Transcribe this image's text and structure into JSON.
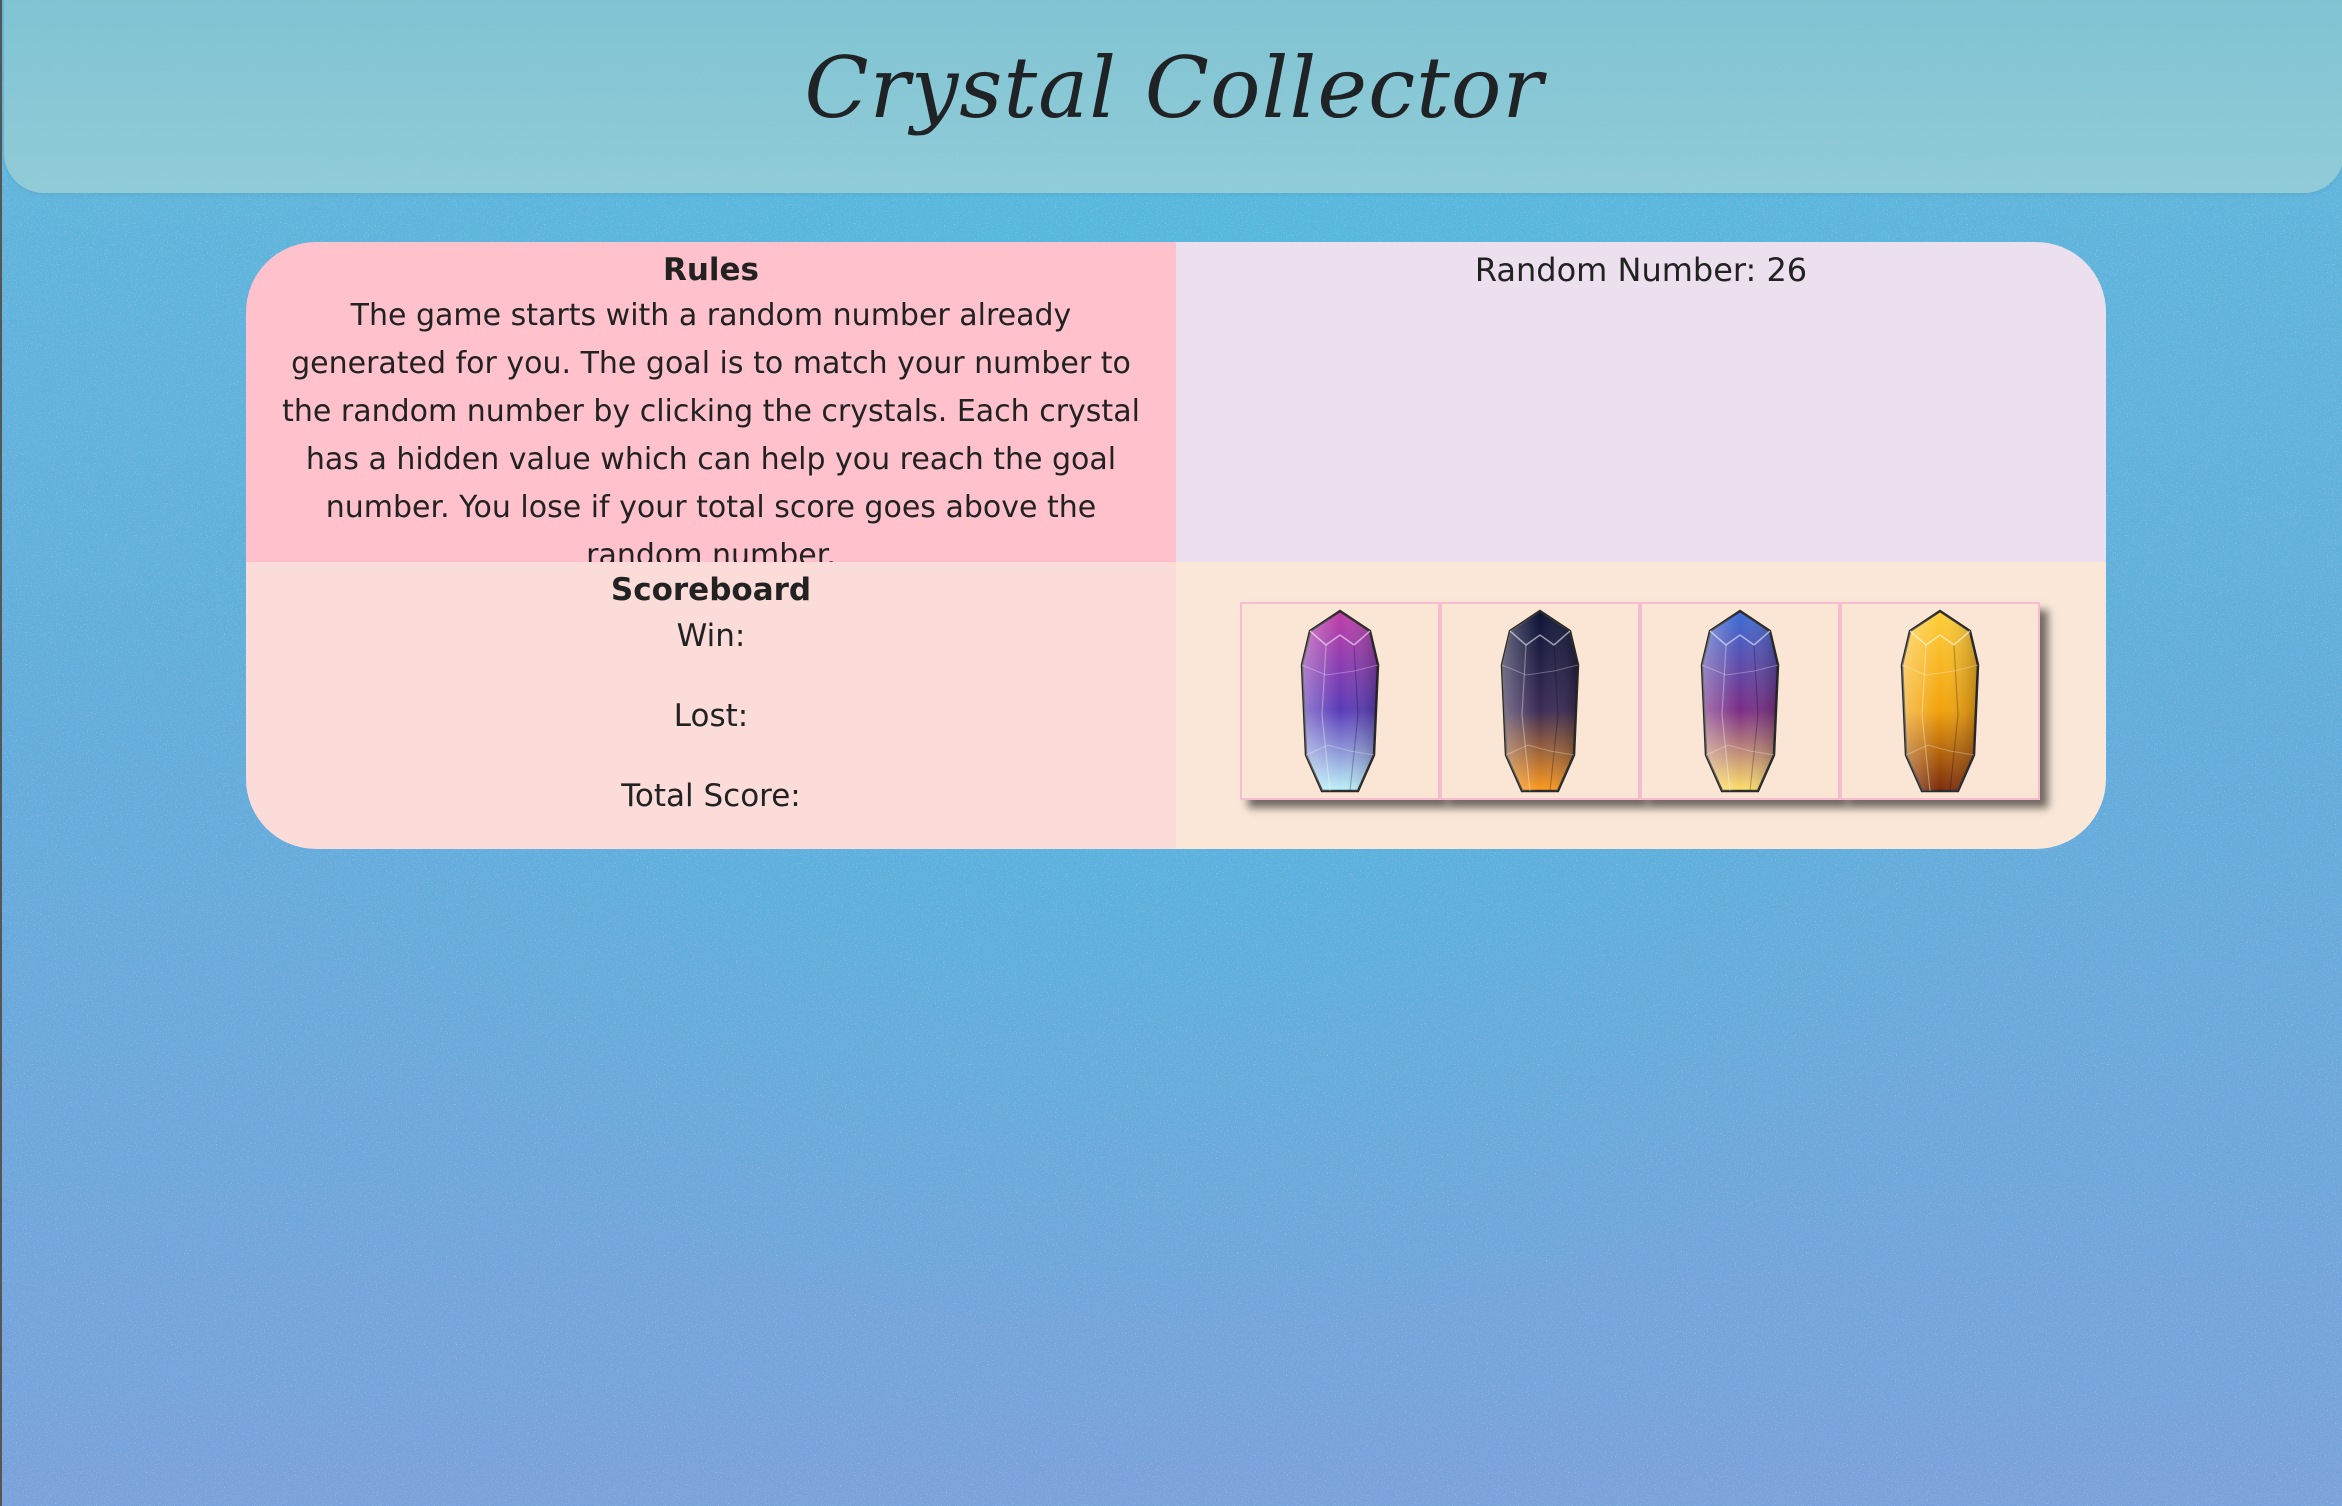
{
  "header": {
    "title": "Crystal Collector"
  },
  "rules": {
    "heading": "Rules",
    "text": "The game starts with a random number already generated for you. The goal is to match your number to the random number by clicking the crystals. Each crystal has a hidden value which can help you reach the goal number. You lose if your total score goes above the random number."
  },
  "random": {
    "label": "Random Number: 26"
  },
  "scoreboard": {
    "heading": "Scoreboard",
    "win_label": "Win:",
    "lost_label": "Lost:",
    "total_label": "Total Score:"
  },
  "crystals": [
    {
      "name": "purple-blue-crystal",
      "top": "#c23fa8",
      "mid": "#5a3bb8",
      "bottom": "#bdf1f8"
    },
    {
      "name": "dark-fire-crystal",
      "top": "#0b1436",
      "mid": "#3a2a55",
      "bottom": "#ff9a1c"
    },
    {
      "name": "nebula-crystal",
      "top": "#3b6ed6",
      "mid": "#7a2d86",
      "bottom": "#ffe16a"
    },
    {
      "name": "amber-crystal",
      "top": "#ffcf3a",
      "mid": "#f2a20c",
      "bottom": "#7a2a0b"
    }
  ],
  "colors": {
    "rules_bg": "#ffc1cc",
    "random_bg": "#ece0ef",
    "scoreboard_bg": "#fbdcd9",
    "crystals_bg": "#fae7d8"
  }
}
